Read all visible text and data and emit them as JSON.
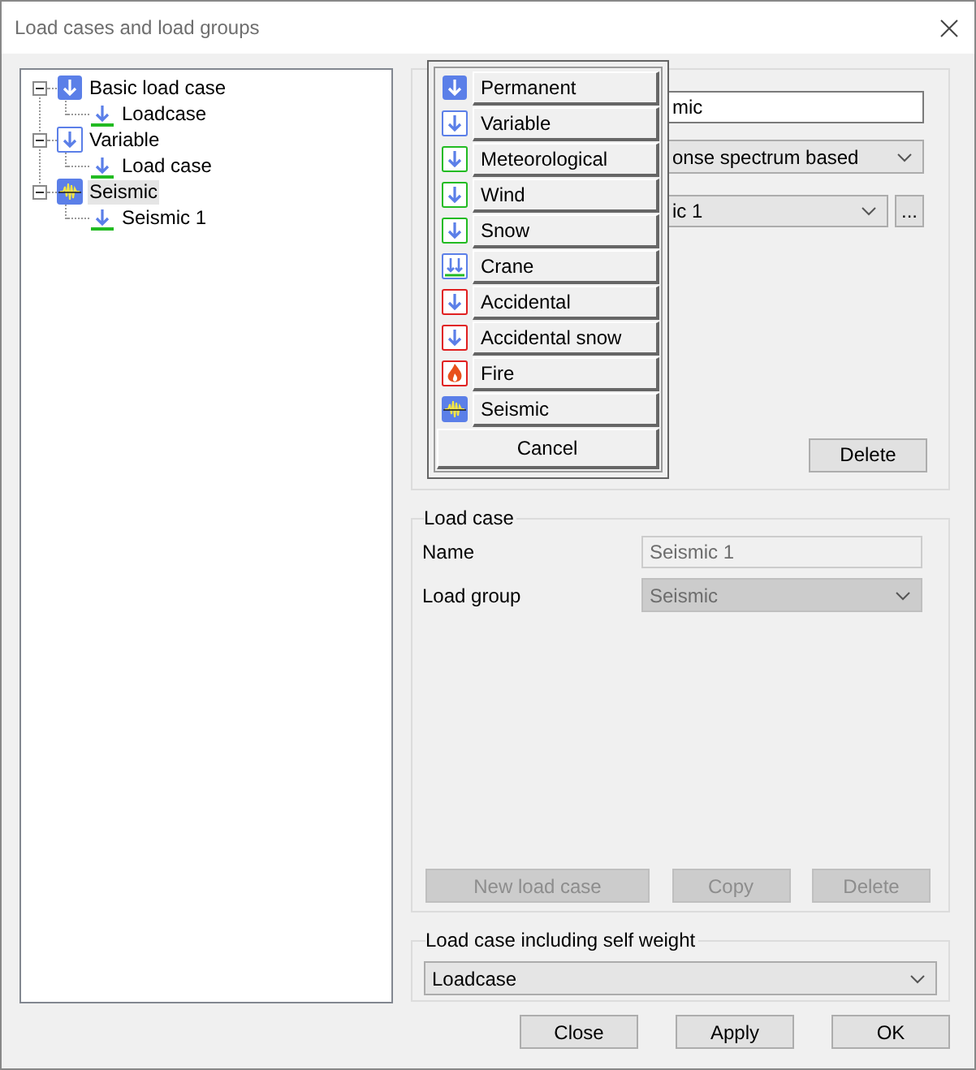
{
  "window": {
    "title": "Load cases and load groups"
  },
  "tree": [
    {
      "label": "Basic load case",
      "kind": "permanent",
      "expanded": true,
      "selected": false,
      "children": [
        {
          "label": "Loadcase",
          "kind": "loadcase",
          "selected": false
        }
      ]
    },
    {
      "label": "Variable",
      "kind": "variable",
      "expanded": true,
      "selected": false,
      "children": [
        {
          "label": "Load case",
          "kind": "loadcase",
          "selected": false
        }
      ]
    },
    {
      "label": "Seismic",
      "kind": "seismic",
      "expanded": true,
      "selected": true,
      "children": [
        {
          "label": "Seismic 1",
          "kind": "loadcase",
          "selected": false
        }
      ]
    }
  ],
  "load_group": {
    "name_value": "mic",
    "type_value": "onse spectrum based",
    "spectrum_value": "ic 1",
    "browse_button": "...",
    "delete_button": "Delete"
  },
  "menu": {
    "items": [
      {
        "label": "Permanent",
        "kind": "permanent"
      },
      {
        "label": "Variable",
        "kind": "variable"
      },
      {
        "label": "Meteorological",
        "kind": "climatic"
      },
      {
        "label": "Wind",
        "kind": "climatic"
      },
      {
        "label": "Snow",
        "kind": "climatic"
      },
      {
        "label": "Crane",
        "kind": "crane"
      },
      {
        "label": "Accidental",
        "kind": "accidental"
      },
      {
        "label": "Accidental snow",
        "kind": "accidental"
      },
      {
        "label": "Fire",
        "kind": "fire"
      },
      {
        "label": "Seismic",
        "kind": "seismic"
      }
    ],
    "cancel": "Cancel"
  },
  "load_case": {
    "title": "Load case",
    "name_label": "Name",
    "name_value": "Seismic 1",
    "group_label": "Load group",
    "group_value": "Seismic",
    "disabled": true,
    "buttons": [
      {
        "label": "New load case",
        "disabled": true
      },
      {
        "label": "Copy",
        "disabled": true
      },
      {
        "label": "Delete",
        "disabled": true
      }
    ]
  },
  "self_weight": {
    "title": "Load case including self weight",
    "value": "Loadcase"
  },
  "buttons": [
    "Close",
    "Apply",
    "OK"
  ]
}
